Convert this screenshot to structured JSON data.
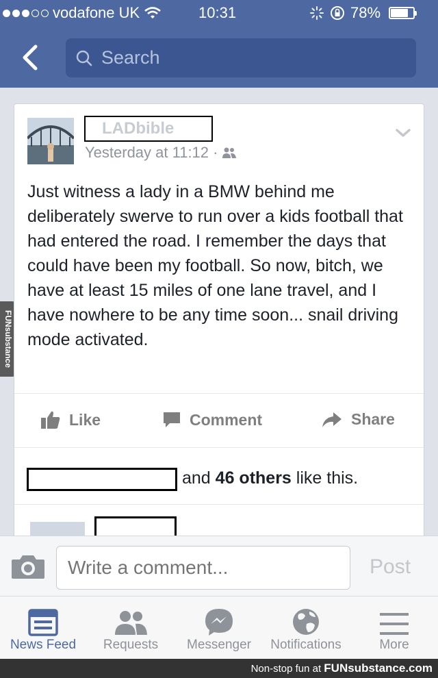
{
  "status_bar": {
    "carrier": "vodafone UK",
    "time": "10:31",
    "battery_percent": "78%",
    "battery_level": 0.78
  },
  "nav": {
    "search_placeholder": "Search"
  },
  "post": {
    "author_placeholder": "LADbible",
    "timestamp": "Yesterday at 11:12 ·",
    "text": "Just witness a lady in a BMW behind me deliberately swerve to run over a kids football that had entered the road. I remember the days that could have been my football. So now, bitch, we have at least 15 miles of one lane travel, and I have nowhere to be any time soon... snail driving mode activated.",
    "actions": {
      "like": "Like",
      "comment": "Comment",
      "share": "Share"
    },
    "likes": {
      "prefix": "and",
      "count": "46 others",
      "suffix": "like this."
    }
  },
  "composer": {
    "placeholder": "Write a comment...",
    "post_label": "Post"
  },
  "tabs": [
    {
      "label": "News Feed",
      "icon": "news-feed-icon",
      "active": true
    },
    {
      "label": "Requests",
      "icon": "friends-icon",
      "active": false
    },
    {
      "label": "Messenger",
      "icon": "messenger-icon",
      "active": false
    },
    {
      "label": "Notifications",
      "icon": "globe-icon",
      "active": false
    },
    {
      "label": "More",
      "icon": "menu-icon",
      "active": false
    }
  ],
  "watermark": {
    "text": "Non-stop fun at",
    "brand": "FUNsubstance.com",
    "side": "FUNsubstance"
  },
  "colors": {
    "brand_blue": "#4e69a2",
    "search_bg": "#3b5690"
  }
}
